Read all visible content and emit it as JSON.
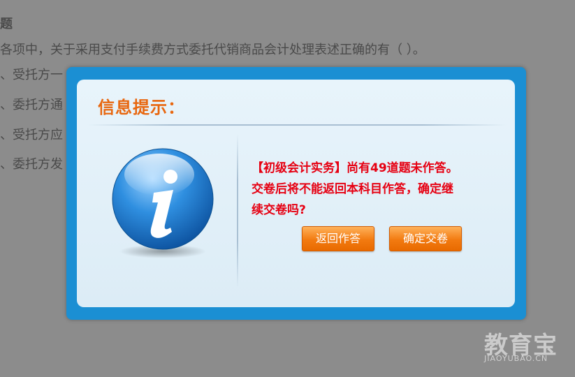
{
  "background": {
    "section_title": "题",
    "question_stem": "各项中，关于采用支付手续费方式委托代销商品会计处理表述正确的有（ ）。",
    "options": [
      "、受托方一",
      "、委托方通",
      "、受托方应",
      "、委托方发"
    ]
  },
  "dialog": {
    "title": "信息提示：",
    "icon": "info-icon",
    "message_line1": "【初级会计实务】尚有49道题未作答。",
    "message_line2": "交卷后将不能返回本科目作答，确定继",
    "message_line3": "续交卷吗?",
    "back_button": "返回作答",
    "confirm_button": "确定交卷"
  },
  "watermark": {
    "brand_cn": "教育宝",
    "brand_en": "JIAOYUBAO.CN"
  },
  "colors": {
    "dialog_border": "#1b8fd3",
    "title": "#e8670f",
    "message": "#e60012",
    "button": "#f27a10"
  }
}
